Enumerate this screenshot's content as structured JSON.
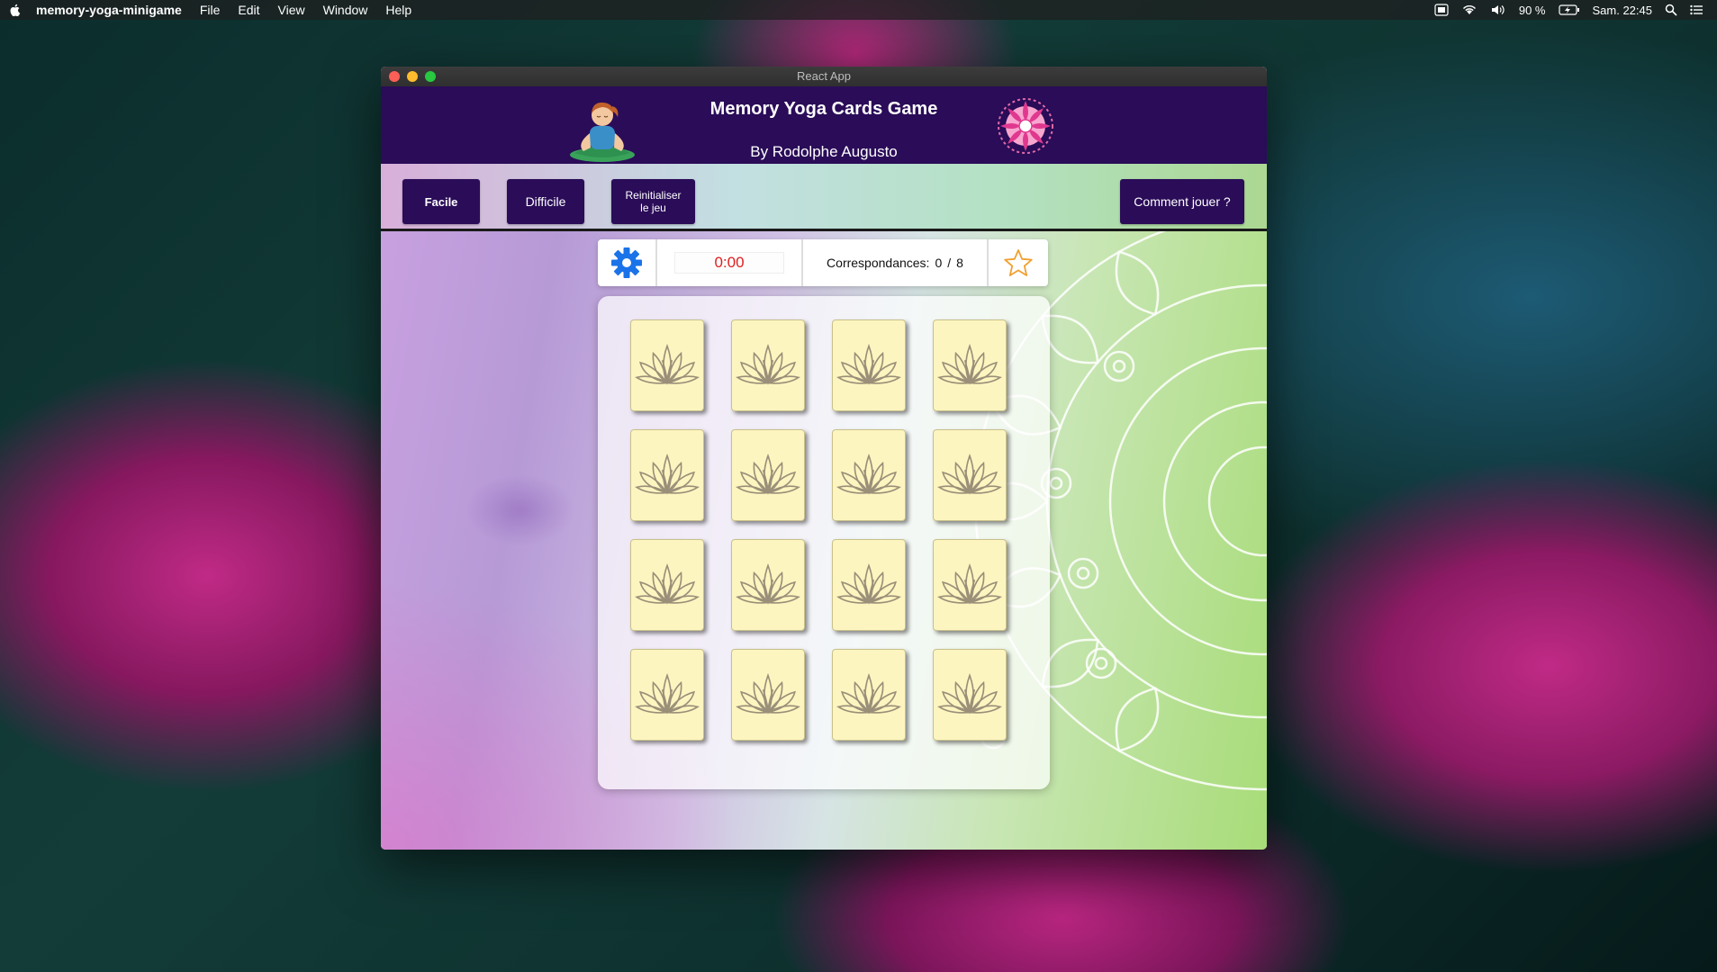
{
  "menubar": {
    "app_name": "memory-yoga-minigame",
    "menus": [
      "File",
      "Edit",
      "View",
      "Window",
      "Help"
    ],
    "battery": "90 %",
    "clock": "Sam. 22:45"
  },
  "window": {
    "title": "React App"
  },
  "header": {
    "title": "Memory Yoga Cards Game",
    "subtitle": "By Rodolphe Augusto"
  },
  "toolbar": {
    "easy_label": "Facile",
    "hard_label": "Difficile",
    "reset_label_line1": "Reinitialiser",
    "reset_label_line2": "le jeu",
    "howto_label": "Comment jouer ?"
  },
  "stats": {
    "timer": "0:00",
    "matches_label": "Correspondances:",
    "matches_found": "0",
    "separator": "/",
    "matches_total": "8"
  },
  "board": {
    "rows": 4,
    "cols": 4,
    "card_back_icon": "lotus-icon",
    "cards_face_down": 16
  },
  "colors": {
    "header_bg": "#2a0c58",
    "button_bg": "#2a0c58",
    "timer_text": "#e02020",
    "card_bg": "#fdf5c0",
    "gear": "#1a73e8",
    "star": "#f0a030"
  }
}
